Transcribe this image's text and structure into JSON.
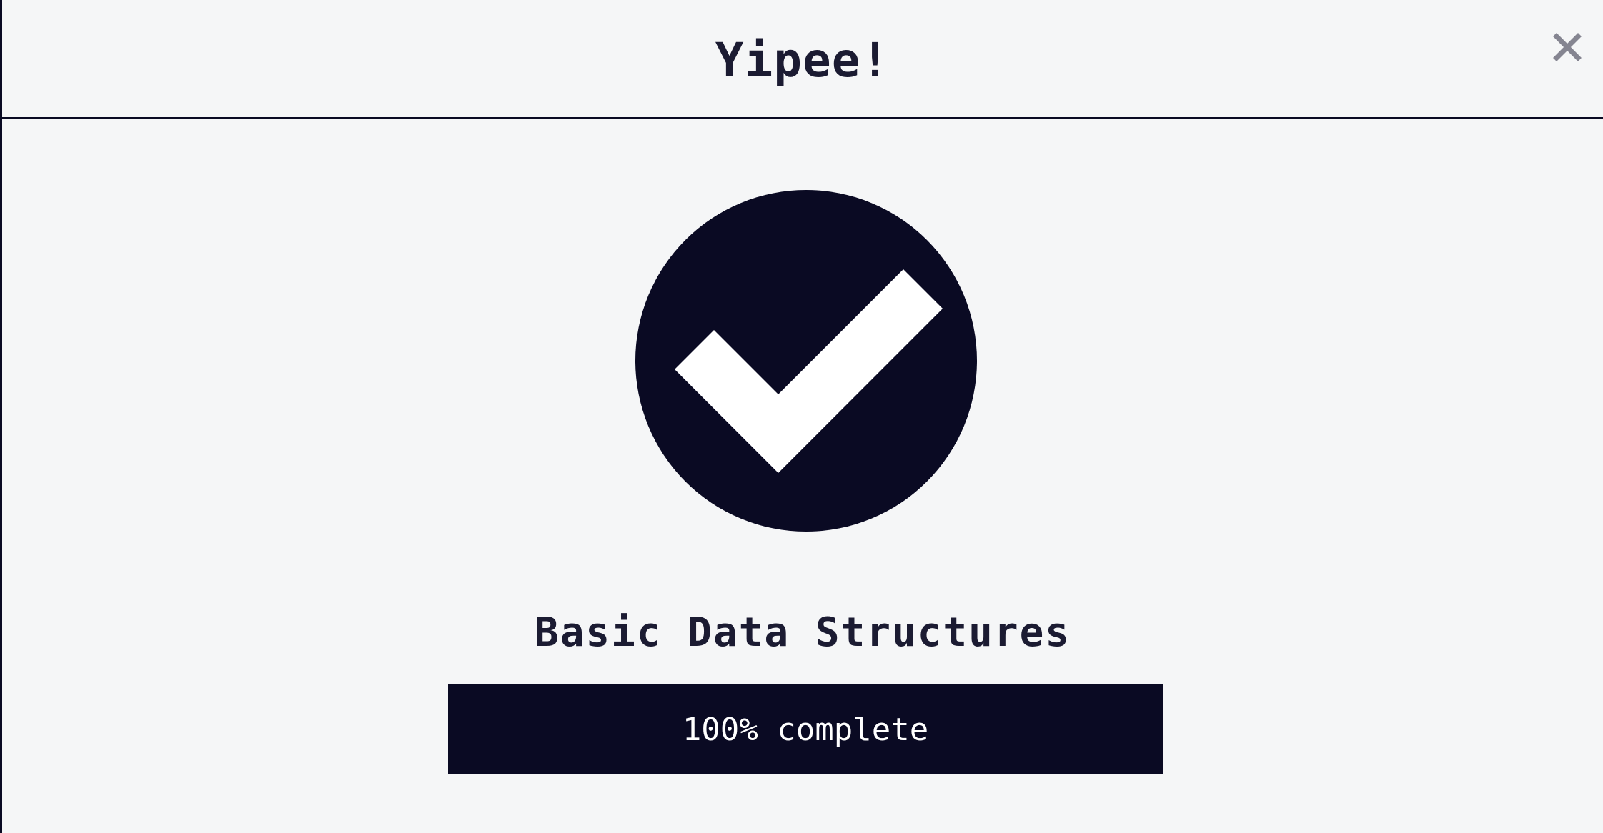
{
  "modal": {
    "title": "Yipee!",
    "close_icon": "close-icon"
  },
  "success": {
    "icon": "checkmark-circle-icon",
    "challenge_name": "Basic Data Structures"
  },
  "progress": {
    "percent": 100,
    "label": "100% complete"
  },
  "colors": {
    "dark": "#0a0a23",
    "text": "#1b1b32",
    "background": "#f5f6f7",
    "close": "#858591",
    "white": "#ffffff"
  }
}
